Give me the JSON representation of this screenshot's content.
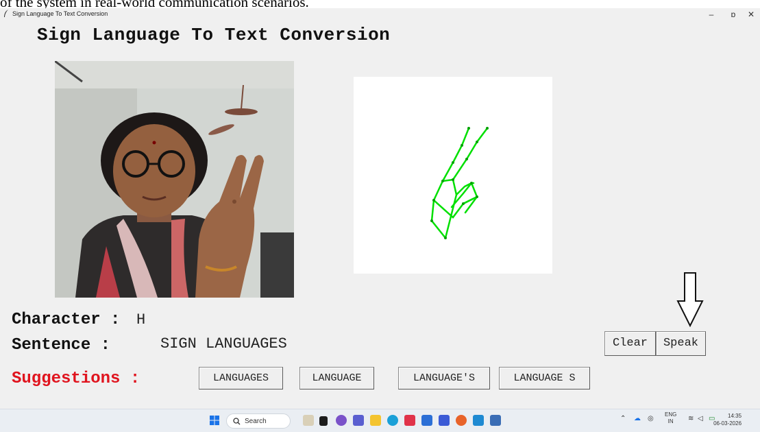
{
  "caption": "of the system in real-world communication scenarios.",
  "window": {
    "title": "Sign Language To Text Conversion",
    "minimize": "–",
    "restore": "ɒ",
    "close": "✕"
  },
  "app": {
    "heading": "Sign Language To Text Conversion",
    "character_label": "Character :",
    "character_value": "H",
    "sentence_label": "Sentence :",
    "sentence_value": "SIGN LANGUAGES",
    "suggestions_label": "Suggestions :",
    "suggestions": [
      "LANGUAGES",
      "LANGUAGE",
      "LANGUAGE'S",
      "LANGUAGE S"
    ],
    "clear_label": "Clear",
    "speak_label": "Speak"
  },
  "taskbar": {
    "search_placeholder": "Search",
    "language": "ENG",
    "region": "IN",
    "time": "14:35",
    "date": "06-03-2026"
  },
  "colors": {
    "suggestions_label": "#e0141e",
    "skeleton_line": "#00e000",
    "window_bg": "#f0f0f0"
  }
}
